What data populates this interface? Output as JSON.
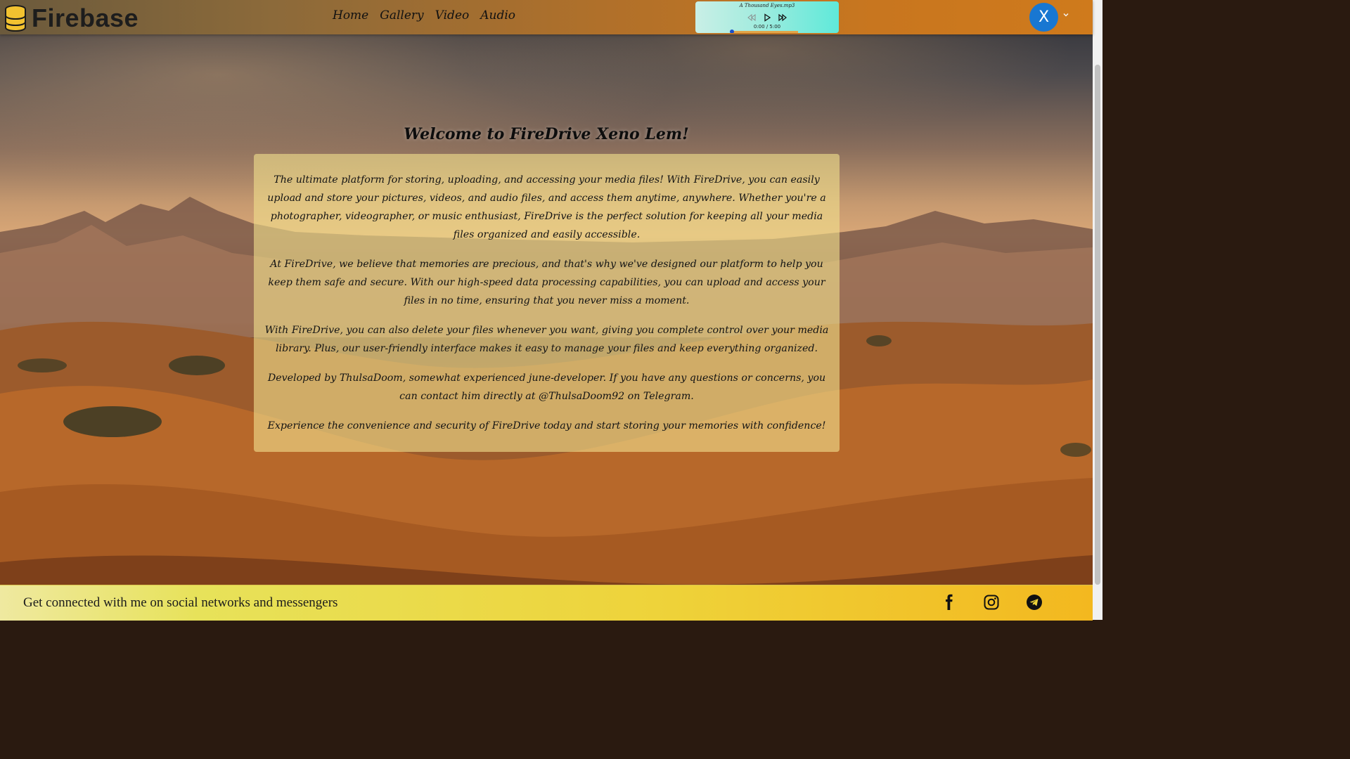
{
  "brand": {
    "name": "Firebase"
  },
  "nav": {
    "items": [
      {
        "label": "Home"
      },
      {
        "label": "Gallery"
      },
      {
        "label": "Video"
      },
      {
        "label": "Audio"
      }
    ]
  },
  "player": {
    "track": "A Thousand Eyes.mp3",
    "time": "0:00 / 5:00",
    "progress_fraction": 0.0,
    "icons": [
      "rewind-icon",
      "play-icon",
      "fast-forward-icon"
    ]
  },
  "user": {
    "initial": "X"
  },
  "main": {
    "title": "Welcome to FireDrive Xeno Lem!",
    "paragraphs": [
      "The ultimate platform for storing, uploading, and accessing your media files! With FireDrive, you can easily upload and store your pictures, videos, and audio files, and access them anytime, anywhere. Whether you're a photographer, videographer, or music enthusiast, FireDrive is the perfect solution for keeping all your media files organized and easily accessible.",
      "At FireDrive, we believe that memories are precious, and that's why we've designed our platform to help you keep them safe and secure. With our high-speed data processing capabilities, you can upload and access your files in no time, ensuring that you never miss a moment.",
      "With FireDrive, you can also delete your files whenever you want, giving you complete control over your media library. Plus, our user-friendly interface makes it easy to manage your files and keep everything organized.",
      "Developed by ThulsaDoom, somewhat experienced june-developer. If you have any questions or concerns, you can contact him directly at @ThulsaDoom92 on Telegram.",
      "Experience the convenience and security of FireDrive today and start storing your memories with confidence!"
    ]
  },
  "footer": {
    "text": "Get connected with me on social networks and messengers",
    "social": [
      "facebook-icon",
      "instagram-icon",
      "telegram-icon"
    ]
  },
  "colors": {
    "header_accent": "#cf7a1c",
    "avatar": "#1877d2",
    "player": "#5fe9d9",
    "footer": "#eed33a"
  }
}
